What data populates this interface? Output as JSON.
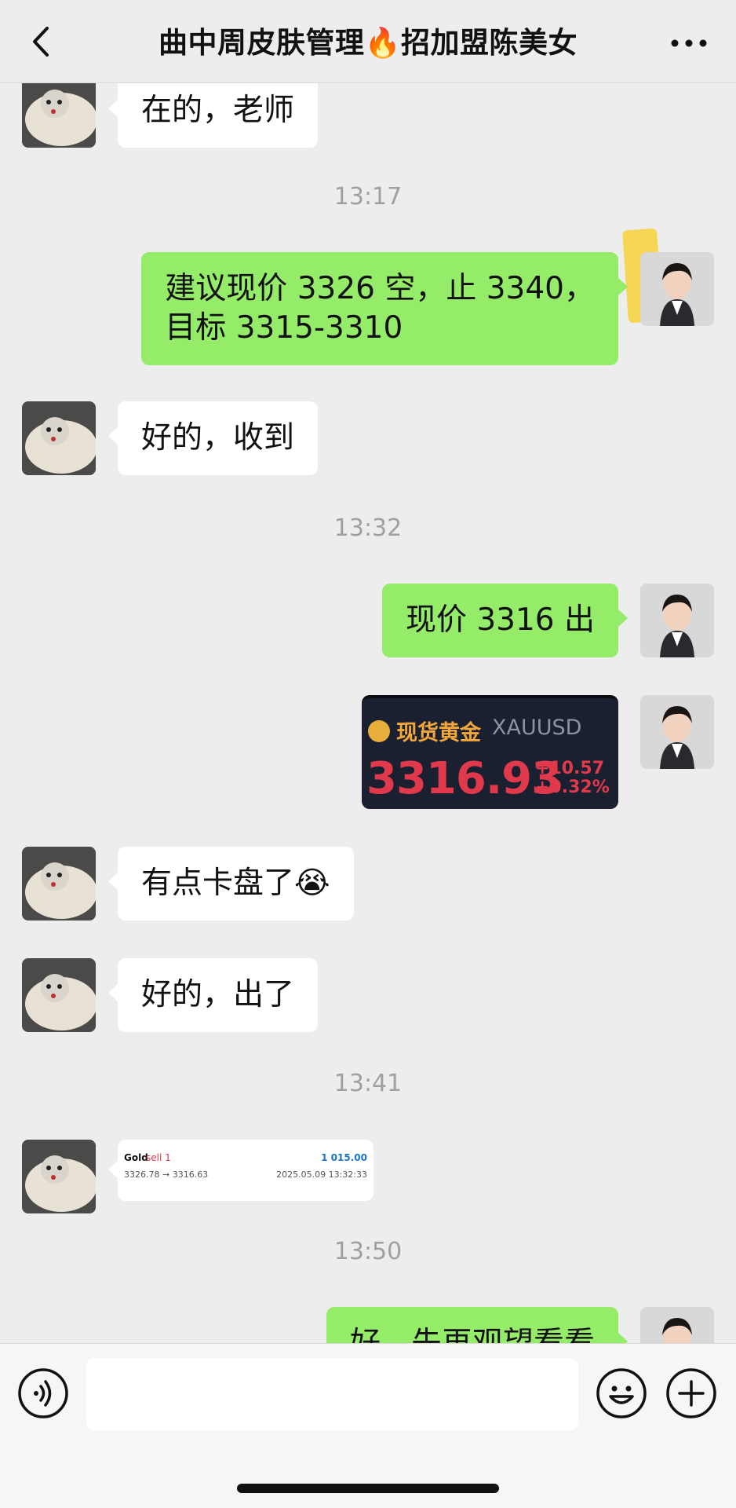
{
  "header": {
    "title": "曲中周皮肤管理🔥招加盟陈美女",
    "back_icon": "chevron-left-icon",
    "more_icon": "more-dots-icon"
  },
  "messages": [
    {
      "side": "in",
      "text": "在的，老师"
    },
    {
      "time": "13:17"
    },
    {
      "side": "out",
      "lines": [
        "建议现价 3326 空，止 3340，",
        "目标 3315-3310"
      ]
    },
    {
      "side": "in",
      "text": "好的，收到"
    },
    {
      "time": "13:32"
    },
    {
      "side": "out",
      "text": "现价 3316 出"
    },
    {
      "side": "out",
      "type": "gold-quote",
      "name": "现货黄金",
      "symbol": "XAUUSD",
      "price": "3316.93",
      "change": "+10.57",
      "change_pct": "+0.32%"
    },
    {
      "side": "in",
      "text": "有点卡盘了😭"
    },
    {
      "side": "in",
      "text": "好的，出了"
    },
    {
      "time": "13:41"
    },
    {
      "side": "in",
      "type": "trade",
      "symbol": "Gold",
      "side_label": "sell 1",
      "profit": "1 015.00",
      "prices": "3326.78 → 3316.63",
      "date": "2025.05.09 13:32:33"
    },
    {
      "time": "13:50"
    },
    {
      "side": "out",
      "text": "好，先再观望看看"
    }
  ],
  "colors": {
    "background": "#ededed",
    "outgoing_bubble": "#95ec69",
    "incoming_bubble": "#ffffff",
    "gold_card_bg": "#1a2030",
    "price_red": "#e0394b"
  },
  "input_bar": {
    "voice_icon": "voice-icon",
    "emoji_icon": "smiley-icon",
    "plus_icon": "plus-circle-icon",
    "placeholder": ""
  }
}
